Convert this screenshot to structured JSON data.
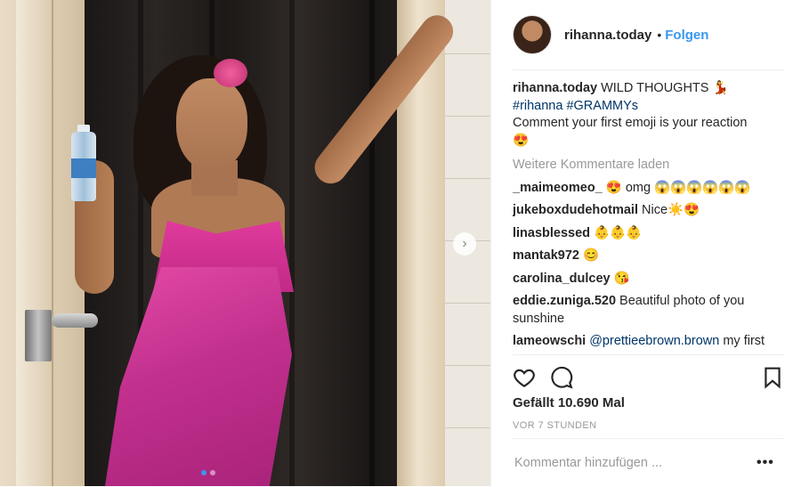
{
  "post": {
    "username": "rihanna.today",
    "separator": "•",
    "follow_label": "Folgen"
  },
  "caption": {
    "username": "rihanna.today",
    "text": "WILD THOUGHTS",
    "emoji": "💃",
    "hashtags": "#rihanna #GRAMMYs",
    "line2": "Comment your first emoji is your reaction",
    "line3": "😍"
  },
  "load_more": "Weitere Kommentare laden",
  "comments": [
    {
      "user": "_maimeomeo_",
      "text": "😍 omg 😱😱😱😱😱😱"
    },
    {
      "user": "jukeboxdudehotmail",
      "text": "Nice☀️😍"
    },
    {
      "user": "linasblessed",
      "text": "👶👶👶"
    },
    {
      "user": "mantak972",
      "text": "😊"
    },
    {
      "user": "carolina_dulcey",
      "text": "😘"
    },
    {
      "user": "eddie.zuniga.520",
      "text": "Beautiful photo of you sunshine"
    },
    {
      "user": "lameowschi",
      "mention": "@prettieebrown.brown",
      "text": "my first"
    }
  ],
  "likes": "Gefällt 10.690 Mal",
  "timestamp": "VOR 7 STUNDEN",
  "comment_input": {
    "placeholder": "Kommentar hinzufügen ..."
  },
  "more_label": "•••",
  "carousel": {
    "next_label": "›"
  },
  "colors": {
    "accent": "#3897f0",
    "dress": "#d63b9c",
    "text": "#262626",
    "muted": "#999999"
  },
  "icons": [
    "heart-icon",
    "comment-icon",
    "bookmark-icon",
    "chevron-right-icon",
    "more-icon"
  ]
}
